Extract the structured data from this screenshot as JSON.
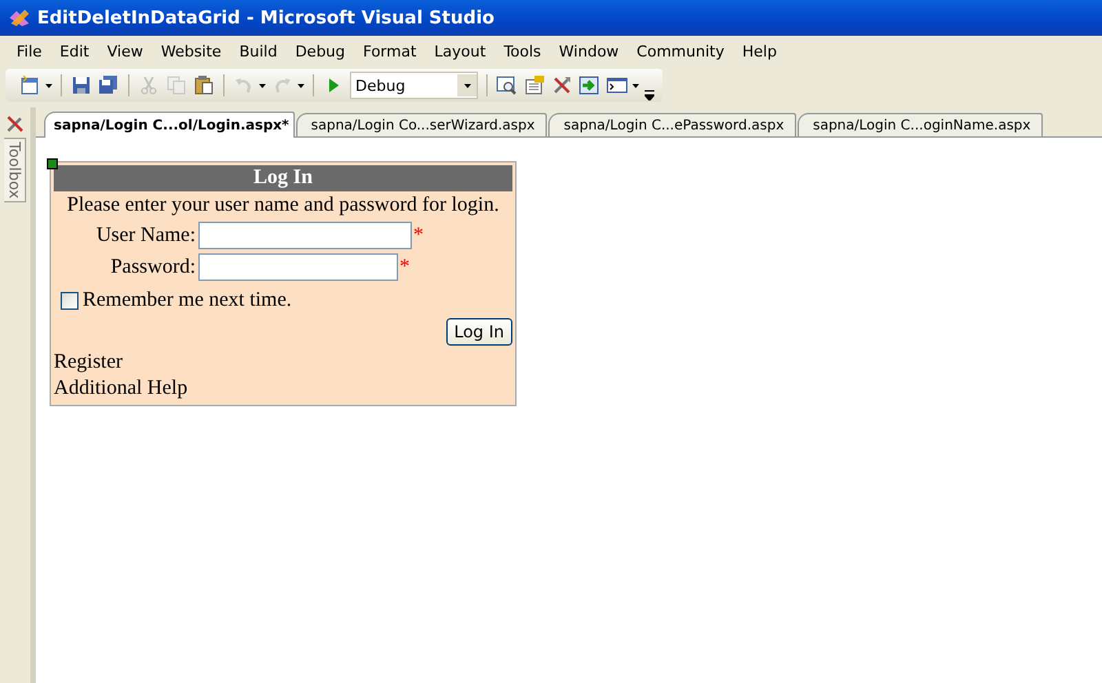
{
  "window": {
    "title": "EditDeletInDataGrid - Microsoft Visual Studio"
  },
  "menu": [
    "File",
    "Edit",
    "View",
    "Website",
    "Build",
    "Debug",
    "Format",
    "Layout",
    "Tools",
    "Window",
    "Community",
    "Help"
  ],
  "toolbar": [
    {
      "kind": "new",
      "disabled": false
    },
    {
      "kind": "sep"
    },
    {
      "kind": "save",
      "disabled": false
    },
    {
      "kind": "save-all",
      "disabled": false
    },
    {
      "kind": "sep"
    },
    {
      "kind": "cut",
      "disabled": true
    },
    {
      "kind": "copy",
      "disabled": true
    },
    {
      "kind": "paste",
      "disabled": false
    },
    {
      "kind": "sep"
    },
    {
      "kind": "undo",
      "disabled": true
    },
    {
      "kind": "redo",
      "disabled": true
    },
    {
      "kind": "sep"
    },
    {
      "kind": "start",
      "disabled": false
    },
    {
      "kind": "combo",
      "value": "Debug"
    },
    {
      "kind": "sep"
    },
    {
      "kind": "find",
      "disabled": false
    },
    {
      "kind": "properties",
      "disabled": false
    },
    {
      "kind": "tools",
      "disabled": false
    },
    {
      "kind": "import",
      "disabled": false
    },
    {
      "kind": "window",
      "disabled": false
    }
  ],
  "sidebar": {
    "label": "Toolbox"
  },
  "tabs": [
    {
      "label": "sapna/Login C...ol/Login.aspx*",
      "selected": true
    },
    {
      "label": "sapna/Login Co...serWizard.aspx",
      "selected": false
    },
    {
      "label": "sapna/Login C...ePassword.aspx",
      "selected": false
    },
    {
      "label": "sapna/Login C...oginName.aspx",
      "selected": false
    }
  ],
  "login": {
    "title": "Log In",
    "instruction": "Please enter your user name and password for login.",
    "fields": [
      {
        "label": "User Name:",
        "required_mark": "*"
      },
      {
        "label": "Password:",
        "required_mark": "*"
      }
    ],
    "remember": {
      "label": "Remember me next time.",
      "checked": false
    },
    "button": "Log In",
    "links": [
      "Register",
      "Additional Help"
    ]
  }
}
